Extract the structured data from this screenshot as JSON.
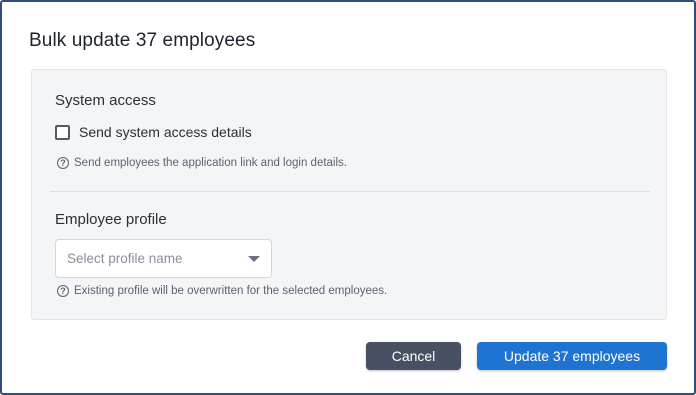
{
  "dialog": {
    "title": "Bulk update 37 employees"
  },
  "system_access": {
    "heading": "System access",
    "checkbox_label": "Send system access details",
    "checkbox_checked": false,
    "help_text": "Send employees the application link and login details."
  },
  "employee_profile": {
    "heading": "Employee profile",
    "select_placeholder": "Select profile name",
    "help_text": "Existing profile will be overwritten for the selected employees."
  },
  "help_icon_glyph": "?",
  "actions": {
    "cancel_label": "Cancel",
    "submit_label": "Update 37 employees"
  },
  "colors": {
    "primary": "#1f73d1",
    "secondary": "#475163",
    "border": "#2e4e7e"
  }
}
